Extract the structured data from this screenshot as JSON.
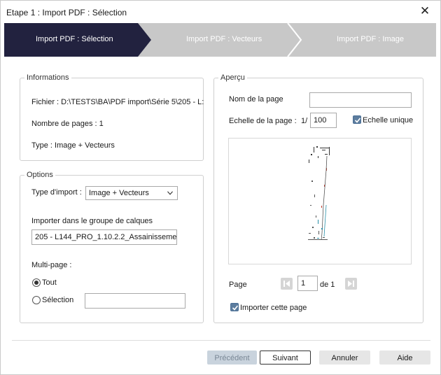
{
  "window": {
    "title": "Etape 1 : Import PDF : Sélection",
    "close_icon": "close-icon"
  },
  "steps": [
    {
      "label": "Import PDF : Sélection",
      "state": "active",
      "color": "#22223f"
    },
    {
      "label": "Import PDF : Vecteurs",
      "state": "inactive",
      "color": "#c8c8c8"
    },
    {
      "label": "Import PDF : Image",
      "state": "inactive",
      "color": "#c8c8c8"
    }
  ],
  "informations": {
    "title": "Informations",
    "file": "Fichier : D:\\TESTS\\BA\\PDF import\\Série 5\\205 - L:",
    "pages": "Nombre de pages : 1",
    "type": "Type : Image + Vecteurs"
  },
  "options": {
    "title": "Options",
    "import_type_label": "Type d'import :",
    "import_type_value": "Image + Vecteurs",
    "layer_group_label": "Importer dans le groupe de calques",
    "layer_group_value": "205 - L144_PRO_1.10.2.2_Assainissemer",
    "multipage_label": "Multi-page :",
    "radio_all": "Tout",
    "radio_selection": "Sélection",
    "selection_value": "",
    "selected": "Tout"
  },
  "apercu": {
    "title": "Aperçu",
    "page_name_label": "Nom de la page",
    "page_name_value": "",
    "scale_label": "Echelle de la page :",
    "scale_prefix": "1/",
    "scale_value": "100",
    "unique_scale_label": "Echelle unique",
    "unique_scale_checked": true,
    "page_label": "Page",
    "page_value": "1",
    "page_of": "de 1",
    "import_page_label": "Importer cette page",
    "import_page_checked": true
  },
  "buttons": {
    "previous": "Précédent",
    "next": "Suivant",
    "cancel": "Annuler",
    "help": "Aide"
  },
  "colors": {
    "active_step": "#22223f",
    "inactive_step": "#c8c8c8",
    "checkbox": "#5d7d9e",
    "disabled_button": "#c9d3dd"
  }
}
